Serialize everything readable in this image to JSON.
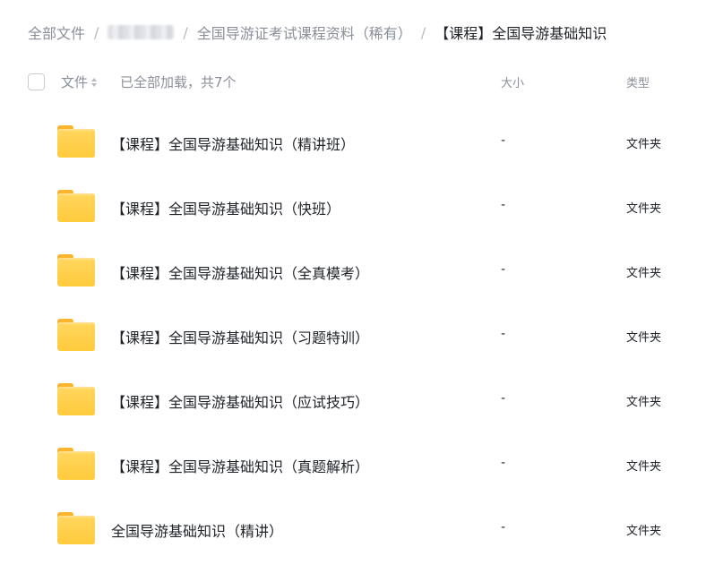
{
  "breadcrumb": {
    "root": "全部文件",
    "separator": "/",
    "level2": "全国导游证考试课程资料（稀有）",
    "current": "【课程】全国导游基础知识"
  },
  "list_header": {
    "col_name": "文件",
    "load_status": "已全部加载，共7个",
    "col_size": "大小",
    "col_type": "类型"
  },
  "files": [
    {
      "name": "【课程】全国导游基础知识（精讲班）",
      "size": "-",
      "type": "文件夹"
    },
    {
      "name": "【课程】全国导游基础知识（快班）",
      "size": "-",
      "type": "文件夹"
    },
    {
      "name": "【课程】全国导游基础知识（全真模考）",
      "size": "-",
      "type": "文件夹"
    },
    {
      "name": "【课程】全国导游基础知识（习题特训）",
      "size": "-",
      "type": "文件夹"
    },
    {
      "name": "【课程】全国导游基础知识（应试技巧）",
      "size": "-",
      "type": "文件夹"
    },
    {
      "name": "【课程】全国导游基础知识（真题解析）",
      "size": "-",
      "type": "文件夹"
    },
    {
      "name": "全国导游基础知识（精讲）",
      "size": "-",
      "type": "文件夹"
    }
  ],
  "colors": {
    "folder": "#ffcb3d",
    "muted_text": "#8a8f99",
    "primary_text": "#1f2329"
  }
}
